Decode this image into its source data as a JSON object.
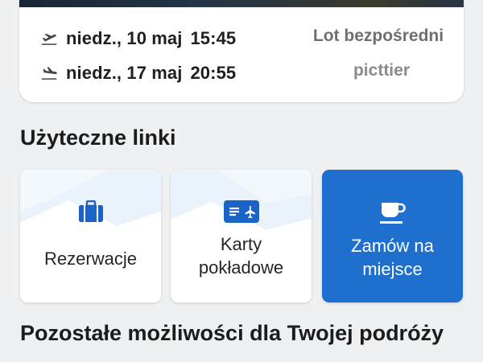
{
  "flight": {
    "outbound": {
      "date": "niedz., 10 maj",
      "time": "15:45"
    },
    "inbound": {
      "date": "niedz., 17 maj",
      "time": "20:55"
    },
    "flight_type": "Lot bezpośredni",
    "operator": "picttier"
  },
  "useful_links": {
    "title": "Użyteczne linki",
    "items": [
      {
        "label": "Rezerwacje",
        "icon": "briefcase-icon"
      },
      {
        "label_line1": "Karty",
        "label_line2": "pokładowe",
        "icon": "boarding-pass-icon"
      },
      {
        "label_line1": "Zamów na",
        "label_line2": "miejsce",
        "icon": "coffee-cup-icon"
      }
    ]
  },
  "more_options": {
    "title": "Pozostałe możliwości dla Twojej podróży"
  },
  "colors": {
    "accent": "#1f6fce",
    "icon_blue": "#1a64c8"
  }
}
